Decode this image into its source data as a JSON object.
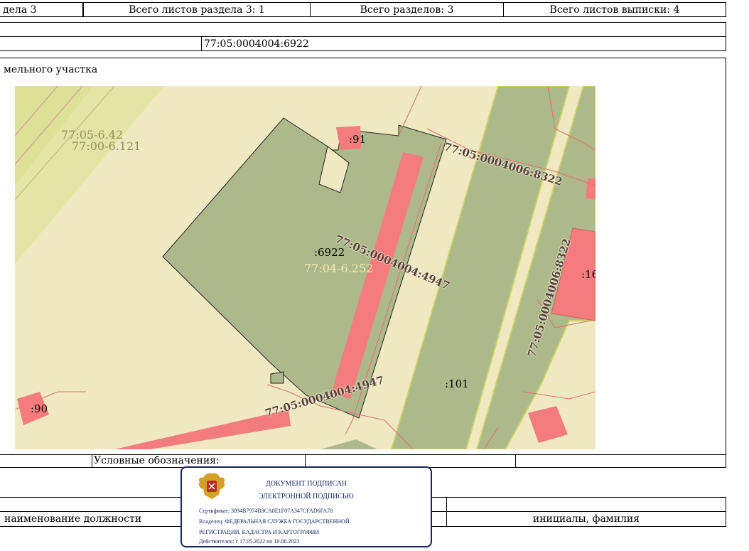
{
  "header": {
    "section": "дела 3",
    "section_sheets": "Всего листов раздела 3: 1",
    "sections_total": "Всего разделов: 3",
    "sheets_total": "Всего листов выписки: 4"
  },
  "cadastral_number": "77:05:0004004:6922",
  "plan_title": "мельного участка",
  "map": {
    "labels": {
      "zone1": "77:05-6.42",
      "zone2": "77:00-6.121",
      "parcel91": ":91",
      "parcel8322_top": "77:05:0004006:8322",
      "parcel6922": ":6922",
      "zone3": "77:04-6.252",
      "parcel4947_mid": "77:05:0004004:4947",
      "parcel8322_side": "77:05:0004006:8322",
      "parcel16": ":16",
      "parcel101": ":101",
      "parcel4947_bottom": "77:05:0004004:4947",
      "parcel90": ":90"
    }
  },
  "legend_label": "Условные обозначения:",
  "signature_row": {
    "position": "наименование должности",
    "name": "инициалы, фамилия"
  },
  "stamp": {
    "line1": "ДОКУМЕНТ ПОДПИСАН",
    "line2": "ЭЛЕКТРОННОЙ ПОДПИСЬЮ",
    "certificate": "Сертификат: 3094B7974B3CA8E1F07A347CFAD6FA78",
    "owner1": "Владелец: ФЕДЕРАЛЬНАЯ СЛУЖБА ГОСУДАРСТВЕННОЙ",
    "owner2": "РЕГИСТРАЦИИ, КАДАСТРА И КАРТОГРАФИИ",
    "valid": "Действителен: с 17.05.2022 по 10.08.2023"
  },
  "colors": {
    "map_background": "#efe8c0",
    "parcel_fill": "#adb98a",
    "building_fill": "#f47c7c",
    "boundary": "#e07070",
    "stamp_border": "#1a2563"
  }
}
